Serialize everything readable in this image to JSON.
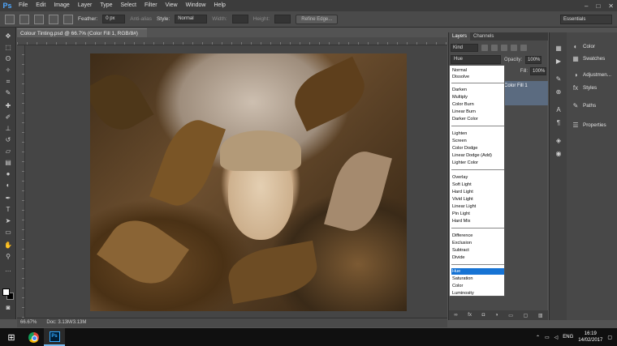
{
  "app": {
    "logo": "Ps",
    "menu": [
      "File",
      "Edit",
      "Image",
      "Layer",
      "Type",
      "Select",
      "Filter",
      "View",
      "Window",
      "Help"
    ],
    "window_controls": [
      "–",
      "□",
      "✕"
    ]
  },
  "options": {
    "feather_label": "Feather:",
    "feather_value": "0 px",
    "antialias_label": "Anti-alias",
    "style_label": "Style:",
    "style_value": "Normal",
    "width_label": "Width:",
    "height_label": "Height:",
    "refine_edge": "Refine Edge...",
    "workspace": "Essentials"
  },
  "document": {
    "tab_title": "Colour Tinting.psd @ 66.7% (Color Fill 1, RGB/8#) *",
    "close_glyph": "×"
  },
  "status": {
    "zoom": "66.67%",
    "doc_size": "Doc: 3.13M/3.13M"
  },
  "layers_panel": {
    "tabs": [
      "Layers",
      "Channels"
    ],
    "kind_label": "Kind",
    "blend_mode": "Hue",
    "opacity_label": "Opacity:",
    "opacity_value": "100%",
    "fill_label": "Fill:",
    "fill_value": "100%",
    "layer_name": "Color Fill 1",
    "bottom_icons": [
      "link-icon",
      "fx-icon",
      "mask-icon",
      "adjustment-icon",
      "group-icon",
      "new-layer-icon",
      "trash-icon"
    ],
    "fx_label": "fx"
  },
  "blend_modes": [
    [
      "Normal",
      "Dissolve"
    ],
    [
      "Darken",
      "Multiply",
      "Color Burn",
      "Linear Burn",
      "Darker Color"
    ],
    [
      "Lighten",
      "Screen",
      "Color Dodge",
      "Linear Dodge (Add)",
      "Lighter Color"
    ],
    [
      "Overlay",
      "Soft Light",
      "Hard Light",
      "Vivid Light",
      "Linear Light",
      "Pin Light",
      "Hard Mix"
    ],
    [
      "Difference",
      "Exclusion",
      "Subtract",
      "Divide"
    ],
    [
      "Hue",
      "Saturation",
      "Color",
      "Luminosity"
    ]
  ],
  "blend_selected": "Hue",
  "right_panels": [
    "Color",
    "Swatches",
    "Adjustmen...",
    "Styles",
    "Paths",
    "Properties"
  ],
  "taskbar": {
    "language": "ENG",
    "time": "16:19",
    "date": "14/02/2017"
  }
}
